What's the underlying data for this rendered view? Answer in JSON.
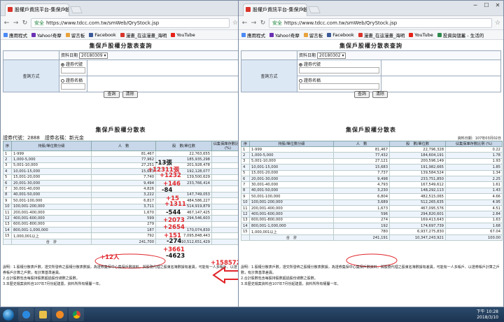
{
  "browser": {
    "tab_title": "股權戶資訊平台-集保戶股",
    "url": "https://www.tdcc.com.tw/smWeb/QryStock.jsp",
    "secure_label": "安全",
    "bookmarks": [
      "應用程式",
      "Yahoo!奇摩",
      "留言板",
      "Facebook",
      "漫畫_在這漫畫_海明",
      "YouTube",
      "投資與儲蓄 - 生活的",
      "藝文記錄 - 台灣"
    ]
  },
  "query": {
    "title": "集保戶股權分散表查詢",
    "date_label": "資料日期",
    "method_label": "查詢方式",
    "code_option": "證券代號",
    "name_option": "證券名稱",
    "search_btn": "查詢",
    "clear_btn": "清除"
  },
  "result": {
    "title": "集保戶股權分散表",
    "code_label": "證券代號：",
    "code_value": "2888",
    "name_label": "證券名稱：",
    "name_value": "新光金",
    "headers": [
      "序",
      "持股/單位數分級",
      "人　數",
      "股　數/單位數",
      "佔集保庫存數比例 (%)"
    ],
    "total_label": "合　計"
  },
  "levels": [
    "1-999",
    "1,000-5,000",
    "5,001-10,000",
    "10,001-15,000",
    "15,001-20,000",
    "20,001-30,000",
    "30,001-40,000",
    "40,001-50,000",
    "50,001-100,000",
    "100,001-200,000",
    "200,001-400,000",
    "400,001-600,000",
    "600,001-800,000",
    "800,001-1,000,000",
    "1,000,001以上"
  ],
  "left": {
    "date": "20180309",
    "people": [
      "81,467",
      "77,962",
      "27,251",
      "15,683",
      "7,740",
      "9,494",
      "4,826",
      "3,222",
      "6,817",
      "3,711",
      "1,670",
      "599",
      "279",
      "187",
      "792"
    ],
    "shares": [
      "22,763,655",
      "185,935,298",
      "201,928,478",
      "192,128,077",
      "139,500,629",
      "233,766,414",
      "",
      "147,749,053",
      "484,586,227",
      "514,919,879",
      "467,147,425",
      "294,546,603",
      "",
      "170,074,830",
      "7,095,848,443"
    ],
    "total_people": "241,700",
    "total_shares": "10,512,651,429"
  },
  "right": {
    "date": "20180302",
    "stock_date": "資料日期：107年03月02日",
    "people": [
      "81,467",
      "77,432",
      "27,121",
      "15,683",
      "7,737",
      "9,498",
      "4,793",
      "3,230",
      "6,804",
      "3,689",
      "1,673",
      "596",
      "274",
      "192",
      "780"
    ],
    "shares": [
      "22,796,328",
      "184,604,191",
      "200,596,149",
      "191,982,665",
      "139,584,524",
      "233,751,850",
      "167,549,612",
      "148,292,113",
      "482,515,065",
      "512,265,635",
      "467,095,576",
      "294,820,601",
      "169,413,643",
      "174,697,739",
      "6,937,275,830"
    ],
    "pct": [
      "0.22",
      "1.78",
      "1.93",
      "1.85",
      "1.34",
      "2.25",
      "1.61",
      "1.43",
      "4.66",
      "4.95",
      "4.51",
      "2.84",
      "1.63",
      "1.68",
      "67.04"
    ],
    "total_people": "241,191",
    "total_shares": "10,347,243,921",
    "total_pct": "100.00"
  },
  "annotations": {
    "ppl": [
      "-13張",
      "+12311張",
      "+1232",
      "+146",
      "-84",
      "+15",
      "+1311",
      "-544",
      "+2073",
      "+2654",
      "+151",
      "-274",
      "+3661",
      "-4623",
      "+158572張"
    ],
    "plus12": "+12人"
  },
  "notes": [
    "說明：1.股權分散表戶數，證交所發佈之股權分散表數據，為證券集保中心集保戶數資料，與股務代理之股東名簿數據有差異，可能有一人多帳戶、以證券帳戶計算之戶數，有計算基準差異。",
    "2.合計股數包含每股持股數超過股份總數之股數。",
    "3.本歷史檔案資料自107年7月份起建置，資料所所有權屬一年。"
  ],
  "taskbar": {
    "time": "下午 10:28",
    "date": "2018/3/10"
  },
  "colors": {
    "annotation": "#e0262b",
    "header": "#c8d7ea"
  }
}
